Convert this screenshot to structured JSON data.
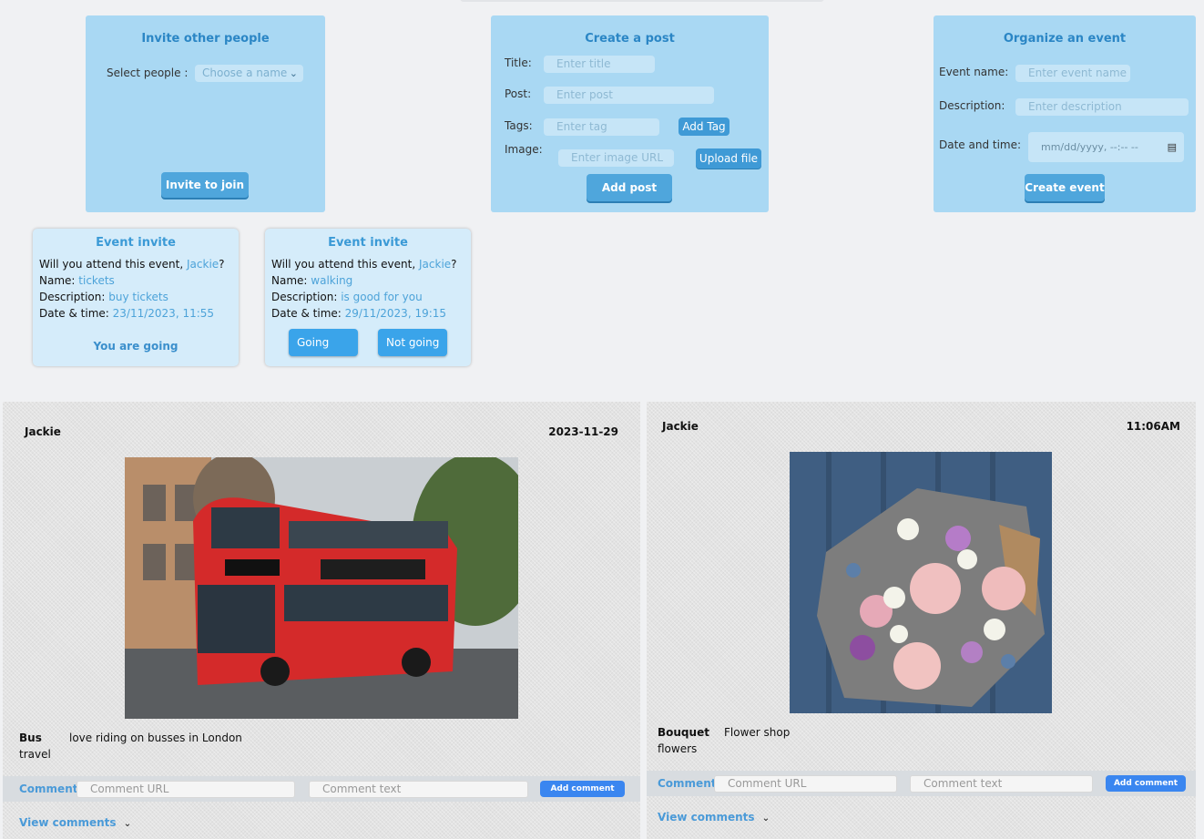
{
  "invite_card": {
    "title": "Invite other people",
    "select_label": "Select people :",
    "select_value": "Choose a name",
    "button": "Invite to join"
  },
  "post_card": {
    "title": "Create a post",
    "title_label": "Title:",
    "title_placeholder": "Enter title",
    "post_label": "Post:",
    "post_placeholder": "Enter post",
    "tags_label": "Tags:",
    "tag_placeholder": "Enter tag",
    "add_tag": "Add Tag",
    "image_label": "Image:",
    "image_placeholder": "Enter image URL",
    "upload": "Upload file",
    "button": "Add post"
  },
  "event_card": {
    "title": "Organize an event",
    "name_label": "Event name:",
    "name_placeholder": "Enter event name",
    "desc_label": "Description:",
    "desc_placeholder": "Enter description",
    "date_label": "Date and time:",
    "date_placeholder": "mm/dd/yyyy, --:-- --",
    "button": "Create event"
  },
  "event_invites": [
    {
      "title": "Event invite",
      "question": "Will you attend this event,",
      "user": "Jackie",
      "qmark": "?",
      "name_label": "Name:",
      "name": "tickets",
      "desc_label": "Description:",
      "desc": "buy tickets",
      "date_label": "Date & time:",
      "date": "23/11/2023, 11:55",
      "status": "You are going"
    },
    {
      "title": "Event invite",
      "question": "Will you attend this event,",
      "user": "Jackie",
      "qmark": "?",
      "name_label": "Name:",
      "name": "walking",
      "desc_label": "Description:",
      "desc": "is good for you",
      "date_label": "Date & time:",
      "date": "29/11/2023, 19:15",
      "going": "Going",
      "not_going": "Not going"
    }
  ],
  "posts": [
    {
      "author": "Jackie",
      "date": "2023-11-29",
      "title": "Bus",
      "text": "love riding on busses in London",
      "tag": "travel",
      "comment_label": "Comment",
      "comment_url_placeholder": "Comment URL",
      "comment_text_placeholder": "Comment text",
      "add_comment": "Add comment",
      "view_comments": "View comments"
    },
    {
      "author": "Jackie",
      "date": "11:06AM",
      "title": "Bouquet",
      "text": "Flower shop",
      "tag": "flowers",
      "comment_label": "Comment",
      "comment_url_placeholder": "Comment URL",
      "comment_text_placeholder": "Comment text",
      "add_comment": "Add comment",
      "view_comments": "View comments"
    }
  ],
  "icons": {
    "chevron": "chevron-down-icon",
    "calendar": "calendar-icon"
  }
}
